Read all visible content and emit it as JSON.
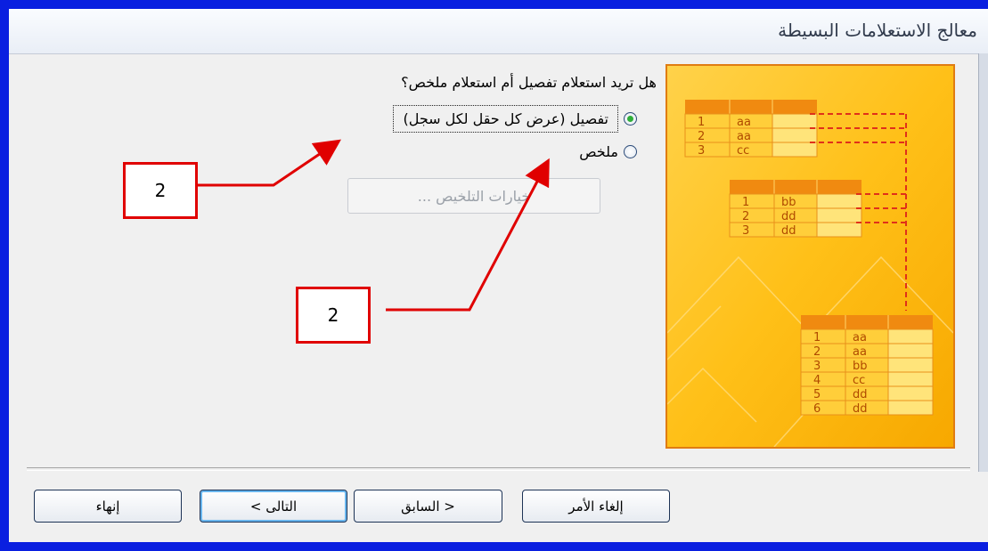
{
  "window": {
    "title": "معالج الاستعلامات البسيطة"
  },
  "question": "هل تريد استعلام تفصيل أم استعلام ملخص؟",
  "options": {
    "detail_label": "تفصيل (عرض كل حقل لكل سجل)",
    "summary_label": "ملخص",
    "selected": "detail"
  },
  "summary_options_button": "خيارات التلخيص ...",
  "buttons": {
    "cancel": "إلغاء الأمر",
    "back": "< السابق",
    "next": "التالى >",
    "finish": "إنهاء"
  },
  "annotations": {
    "callout_1": "2",
    "callout_2": "2"
  },
  "illustration": {
    "table_1": [
      [
        "1",
        "aa"
      ],
      [
        "2",
        "aa"
      ],
      [
        "3",
        "cc"
      ]
    ],
    "table_2": [
      [
        "1",
        "bb"
      ],
      [
        "2",
        "dd"
      ],
      [
        "3",
        "dd"
      ]
    ],
    "table_3": [
      [
        "1",
        "aa"
      ],
      [
        "2",
        "aa"
      ],
      [
        "3",
        "bb"
      ],
      [
        "4",
        "cc"
      ],
      [
        "5",
        "dd"
      ],
      [
        "6",
        "dd"
      ]
    ]
  },
  "colors": {
    "accent_orange": "#e07c12",
    "annotation_red": "#e00000",
    "window_border": "#0a1fe0",
    "radio_selected": "#2fae3a"
  }
}
